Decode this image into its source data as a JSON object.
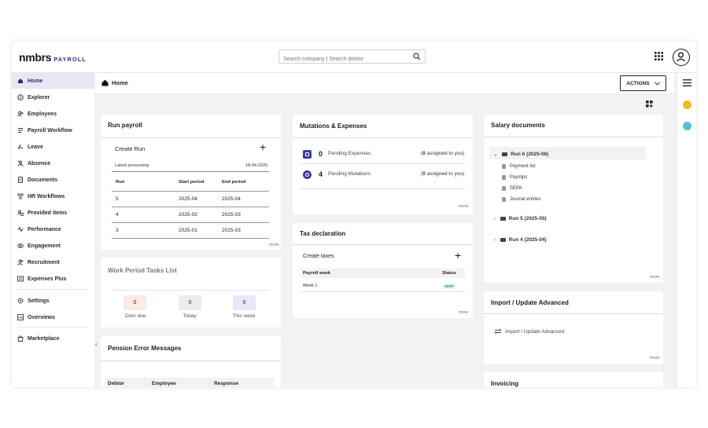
{
  "app": {
    "logo": "nmbrs",
    "logo_sub": "PAYROLL",
    "search_placeholder": "Search company | Search debtor"
  },
  "sidebar": {
    "items": [
      {
        "label": "Home",
        "icon": "home-icon"
      },
      {
        "label": "Explorer",
        "icon": "compass-icon"
      },
      {
        "label": "Employees",
        "icon": "users-icon"
      },
      {
        "label": "Payroll Workflow",
        "icon": "workflow-icon"
      },
      {
        "label": "Leave",
        "icon": "leave-icon"
      },
      {
        "label": "Absence",
        "icon": "absence-icon"
      },
      {
        "label": "Documents",
        "icon": "document-icon"
      },
      {
        "label": "HR Workflows",
        "icon": "hr-workflow-icon"
      },
      {
        "label": "Provided items",
        "icon": "provided-items-icon"
      },
      {
        "label": "Performance",
        "icon": "performance-icon"
      },
      {
        "label": "Engagement",
        "icon": "engagement-icon"
      },
      {
        "label": "Recruitment",
        "icon": "recruitment-icon"
      },
      {
        "label": "Expenses Plus",
        "icon": "expenses-icon"
      },
      {
        "label": "Settings",
        "icon": "gear-icon"
      },
      {
        "label": "Overviews",
        "icon": "overview-icon"
      },
      {
        "label": "Marketplace",
        "icon": "marketplace-icon"
      }
    ]
  },
  "header": {
    "breadcrumb": "Home",
    "actions_label": "ACTIONS"
  },
  "run_payroll": {
    "title": "Run payroll",
    "create_label": "Create Run",
    "latest_label": "Latest processing",
    "latest_date": "18-04-2025",
    "columns": [
      "Run",
      "Start period",
      "End period"
    ],
    "rows": [
      [
        "5",
        "2025-04",
        "2025-04"
      ],
      [
        "4",
        "2025-02",
        "2025-03"
      ],
      [
        "3",
        "2025-01",
        "2025-03"
      ]
    ],
    "more": "more"
  },
  "work_period": {
    "title": "Work Period Tasks List",
    "stats": [
      {
        "value": "0",
        "label": "Over due",
        "color": "#fde8e4"
      },
      {
        "value": "0",
        "label": "Today",
        "color": "#ececec"
      },
      {
        "value": "0",
        "label": "This week",
        "color": "#ece6fb"
      }
    ]
  },
  "pension": {
    "title": "Pension Error Messages",
    "columns": [
      "Debtor",
      "Employee",
      "Response"
    ]
  },
  "mutations": {
    "title": "Mutations & Expenses",
    "rows": [
      {
        "count": "0",
        "label": "Pending Expenses",
        "assigned_num": "0",
        "assigned_text": " assigned to you)"
      },
      {
        "count": "4",
        "label": "Pending Mutations",
        "assigned_num": "0",
        "assigned_text": " assigned to you)"
      }
    ],
    "more": "more"
  },
  "tax": {
    "title": "Tax declaration",
    "create_label": "Create taxes",
    "columns": [
      "Payroll week",
      "Status"
    ],
    "rows": [
      {
        "week": "Week 1",
        "status": "SENT"
      }
    ],
    "more": "more"
  },
  "salary_docs": {
    "title": "Salary documents",
    "runs": [
      "Run 6 (2025-06)",
      "Run 5 (2025-05)",
      "Run 4 (2025-04)"
    ],
    "files": [
      "Payment list",
      "Payslips",
      "SEPA",
      "Journal entries"
    ],
    "more": "more"
  },
  "import_update": {
    "title": "Import / Update Advanced",
    "link_label": "Import / Update Advanced",
    "more": "more"
  },
  "invoicing": {
    "title": "Invoicing"
  },
  "colors": {
    "brand": "#2b2f7a",
    "active_bg": "#e7e6f5",
    "sent_badge": "#2e9e55",
    "rail_yellow": "#f5b921",
    "rail_teal": "#4fc3d5"
  }
}
